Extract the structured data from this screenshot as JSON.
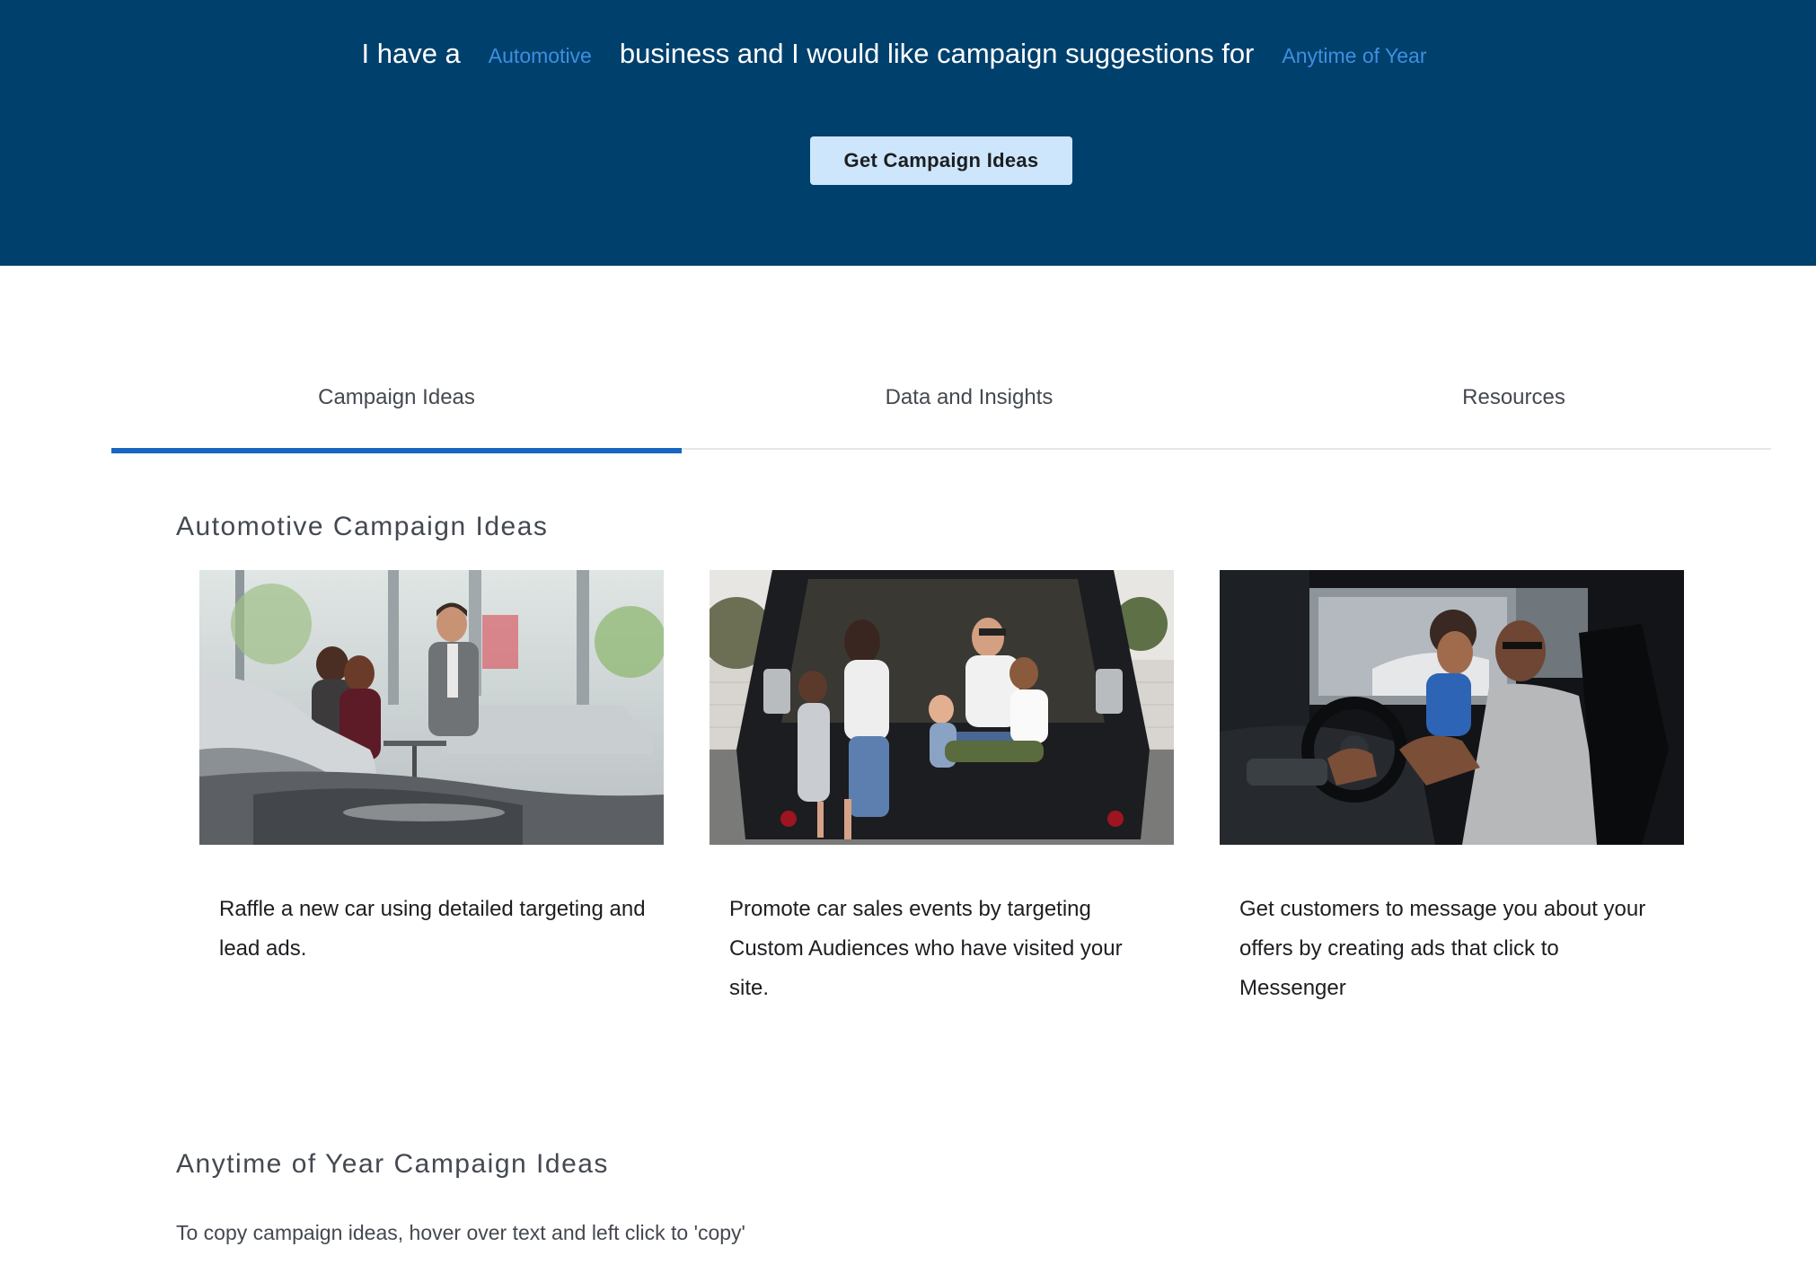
{
  "hero": {
    "prefix": "I have a",
    "business_select": "Automotive",
    "middle": "business and I would like campaign suggestions for",
    "time_select": "Anytime of Year",
    "cta_label": "Get Campaign Ideas"
  },
  "tabs": [
    {
      "label": "Campaign Ideas",
      "active": true
    },
    {
      "label": "Data and Insights",
      "active": false
    },
    {
      "label": "Resources",
      "active": false
    }
  ],
  "sections": {
    "automotive_title": "Automotive Campaign Ideas",
    "anytime_title": "Anytime of Year Campaign Ideas",
    "copy_hint": "To copy campaign ideas, hover over text and left click to 'copy'"
  },
  "cards": [
    {
      "caption": "Raffle a new car using detailed targeting and lead ads.",
      "image": "car-dealership-photo"
    },
    {
      "caption": "Promote car sales events by targeting Custom Audiences who have visited your site.",
      "image": "family-in-car-trunk-photo"
    },
    {
      "caption": "Get customers to message you about your offers by creating ads that click to Messenger",
      "image": "couple-in-car-photo"
    }
  ],
  "colors": {
    "hero_bg": "#00406d",
    "select_text": "#3f8fe0",
    "cta_bg": "#cde6fb",
    "tab_active_underline": "#1866c2"
  }
}
